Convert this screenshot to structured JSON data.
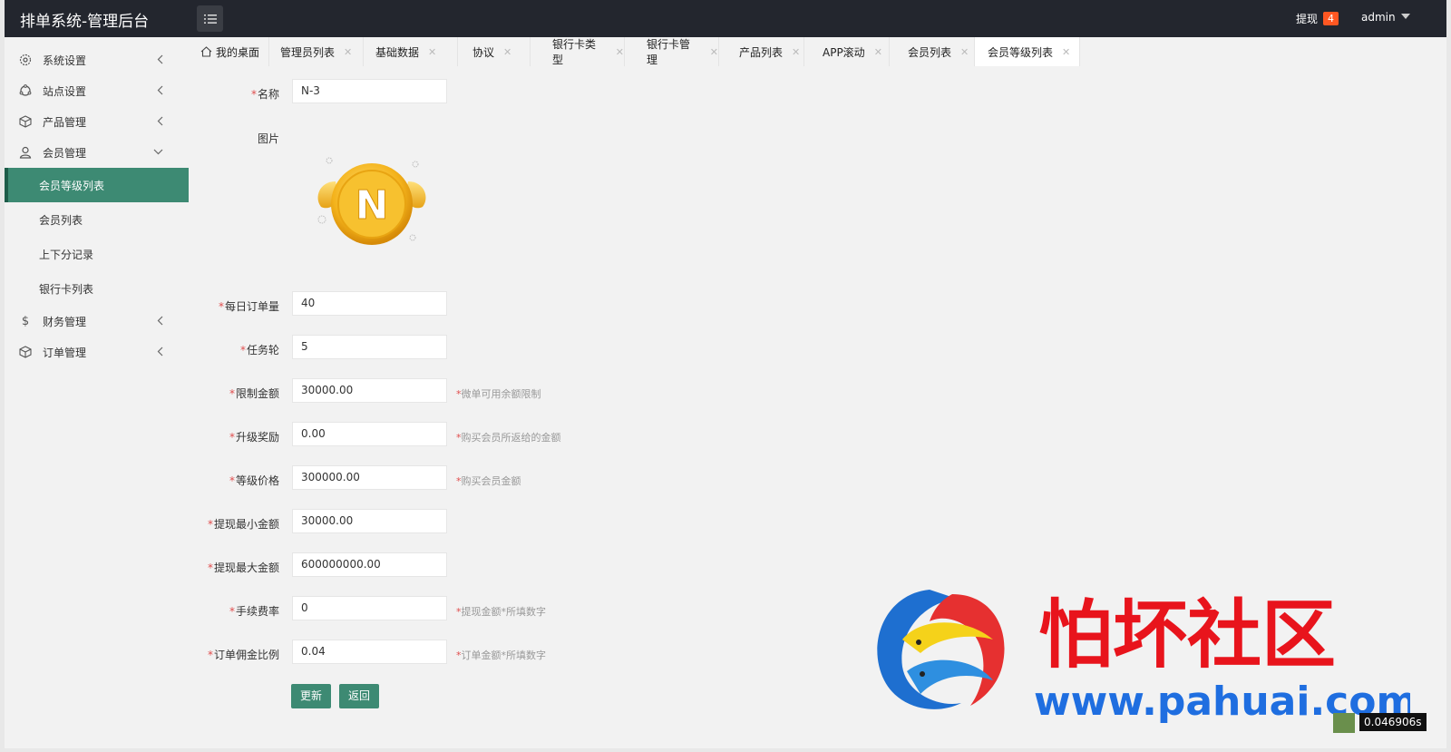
{
  "app": {
    "title": "排单系统-管理后台",
    "withdraw_label": "提现",
    "withdraw_count": "4",
    "username": "admin"
  },
  "sidebar": {
    "items": [
      {
        "label": "系统设置",
        "icon": "gear-icon"
      },
      {
        "label": "站点设置",
        "icon": "site-icon"
      },
      {
        "label": "产品管理",
        "icon": "box-icon"
      },
      {
        "label": "会员管理",
        "icon": "user-icon"
      },
      {
        "label": "财务管理",
        "icon": "dollar-icon"
      },
      {
        "label": "订单管理",
        "icon": "box-icon"
      }
    ],
    "member_sub": [
      {
        "label": "会员等级列表",
        "active": true
      },
      {
        "label": "会员列表"
      },
      {
        "label": "上下分记录"
      },
      {
        "label": "银行卡列表"
      }
    ]
  },
  "tabs": [
    {
      "label": "我的桌面"
    },
    {
      "label": "管理员列表"
    },
    {
      "label": "基础数据"
    },
    {
      "label": "协议"
    },
    {
      "label": "银行卡类型"
    },
    {
      "label": "银行卡管理"
    },
    {
      "label": "产品列表"
    },
    {
      "label": "APP滚动"
    },
    {
      "label": "会员列表"
    },
    {
      "label": "会员等级列表",
      "active": true
    }
  ],
  "form": {
    "name": {
      "label": "名称",
      "value": "N-3"
    },
    "image": {
      "label": "图片",
      "coin_letter": "N"
    },
    "daily_orders": {
      "label": "每日订单量",
      "value": "40"
    },
    "rounds": {
      "label": "任务轮",
      "value": "5"
    },
    "limit_amount": {
      "label": "限制金额",
      "value": "30000.00",
      "hint": "微单可用余额限制"
    },
    "upgrade_reward": {
      "label": "升级奖励",
      "value": "0.00",
      "hint": "购买会员所返给的金额"
    },
    "level_price": {
      "label": "等级价格",
      "value": "300000.00",
      "hint": "购买会员金额"
    },
    "min_withdraw": {
      "label": "提现最小金额",
      "value": "30000.00"
    },
    "max_withdraw": {
      "label": "提现最大金额",
      "value": "600000000.00"
    },
    "fee_rate": {
      "label": "手续费率",
      "value": "0",
      "hint": "提现金额*所填数字"
    },
    "commission_rate": {
      "label": "订单佣金比例",
      "value": "0.04",
      "hint": "订单金额*所填数字"
    },
    "update_button": "更新",
    "back_button": "返回"
  },
  "watermark": {
    "title": "怕坏社区",
    "url": "www.pahuai.com"
  },
  "timer": "0.046906s",
  "colors": {
    "accent": "#3d8a73",
    "topbar": "#23262e",
    "required": "#e04e4e",
    "badge": "#ff5722"
  }
}
